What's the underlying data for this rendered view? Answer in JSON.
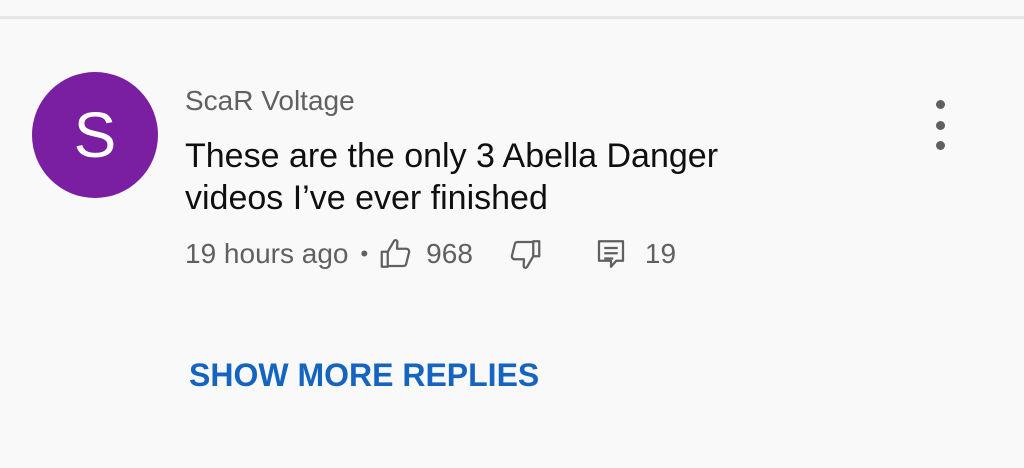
{
  "comment": {
    "avatar_letter": "S",
    "avatar_color": "#7b1fa2",
    "author": "ScaR Voltage",
    "text": "These are the only 3 Abella Danger videos I’ve ever finished",
    "timestamp": "19 hours ago",
    "separator": "•",
    "like_count": "968",
    "reply_count": "19",
    "icons": {
      "like": "thumbs-up-icon",
      "dislike": "thumbs-down-icon",
      "reply": "comment-icon",
      "menu": "more-vertical-icon"
    }
  },
  "replies": {
    "show_more_label": "SHOW MORE REPLIES",
    "link_color": "#1565c0"
  }
}
